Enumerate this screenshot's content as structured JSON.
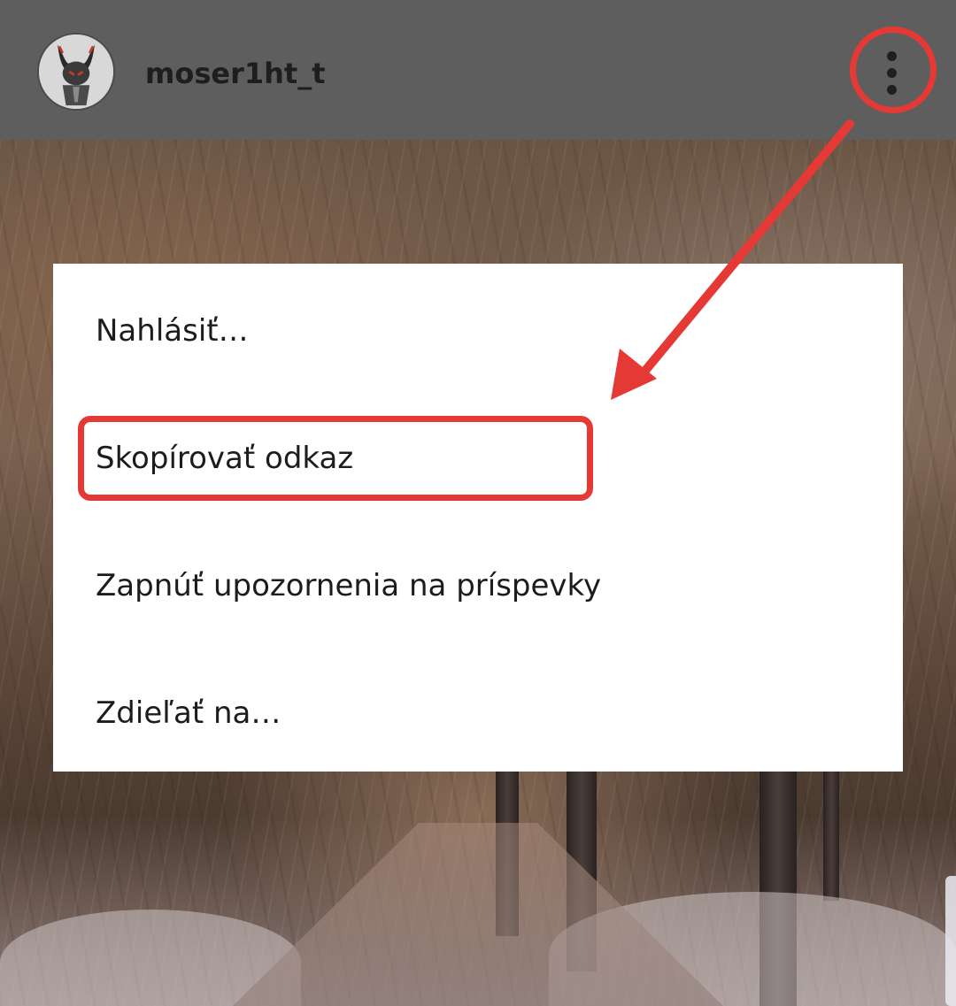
{
  "header": {
    "username": "moser1ht_t",
    "avatar_icon": "avatar-icon",
    "more_icon": "more-vertical-icon"
  },
  "menu": {
    "items": [
      {
        "label": "Nahlásiť…"
      },
      {
        "label": "Skopírovať odkaz"
      },
      {
        "label": "Zapnúť upozornenia na príspevky"
      },
      {
        "label": "Zdieľať na…"
      }
    ]
  },
  "annotations": {
    "highlight_color": "#e53935"
  }
}
